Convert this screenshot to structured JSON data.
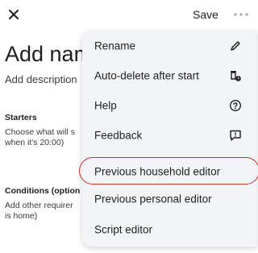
{
  "header": {
    "save_label": "Save"
  },
  "page": {
    "title": "Add name",
    "description": "Add description"
  },
  "starters": {
    "heading": "Starters",
    "line1": "Choose what will s",
    "line2": "when it's 20:00)"
  },
  "conditions": {
    "heading": "Conditions (option",
    "line1": "Add other requirer",
    "line2": "is home)"
  },
  "menu": {
    "items": [
      {
        "label": "Rename",
        "icon": "pencil-icon"
      },
      {
        "label": "Auto-delete after start",
        "icon": "auto-delete-icon"
      },
      {
        "label": "Help",
        "icon": "help-icon"
      },
      {
        "label": "Feedback",
        "icon": "feedback-icon"
      },
      {
        "label": "Previous household editor",
        "icon": ""
      },
      {
        "label": "Previous personal editor",
        "icon": ""
      },
      {
        "label": "Script editor",
        "icon": ""
      }
    ],
    "highlight_color": "#c0352b"
  }
}
